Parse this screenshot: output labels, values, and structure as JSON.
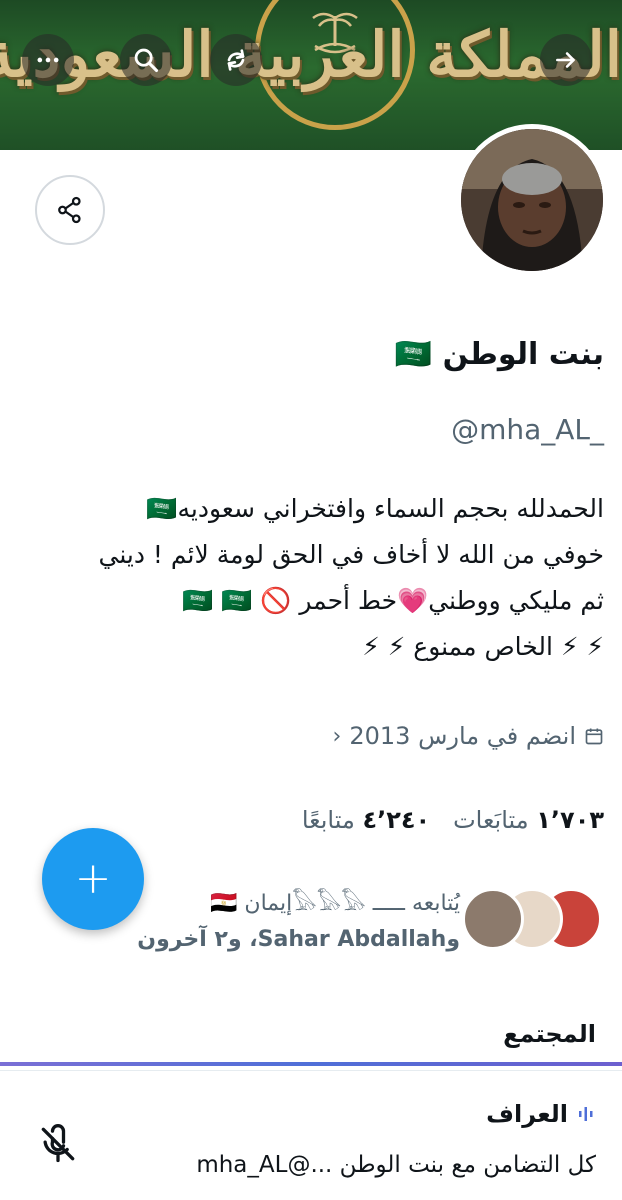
{
  "banner": {
    "text": "المملكة العربية السعودية",
    "icons": [
      "arrow-right-icon",
      "share-icon",
      "search-icon",
      "more-icon"
    ]
  },
  "profile": {
    "name": "بنت الوطن 🇸🇦",
    "handle": "@mha_AL_",
    "bio": [
      "الحمدلله بحجم السماء وافتخراني سعوديه🇸🇦",
      "خوفي من الله لا أخاف في الحق لومة لائم ! ديني",
      "ثم مليكي ووطني💗خط أحمر 🚫 🇸🇦 🇸🇦",
      "⚡ ⚡ الخاص ممنوع ⚡ ⚡"
    ],
    "joined": "انضم في مارس 2013",
    "following_count": "١٬٧٠٣",
    "following_label": "متابَعات",
    "followers_count": "٤٬٢٤٠",
    "followers_label": "متابعًا"
  },
  "followed_by": {
    "line1": "يُتابعه ـــــ 𓅃𓅃𓅃إيمان 🇪🇬",
    "line2": "وSahar Abdallah، و٢ آخرون"
  },
  "fab": {
    "label": "+"
  },
  "community": {
    "title": "المجتمع",
    "post_author": "العراف",
    "post_text": "كل التضامن مع  بنت الوطن ...@mha_AL"
  },
  "colors": {
    "accent": "#1d9bf0",
    "banner_green": "#2b6a2f",
    "gold": "#caa24a",
    "muted": "#536471"
  }
}
